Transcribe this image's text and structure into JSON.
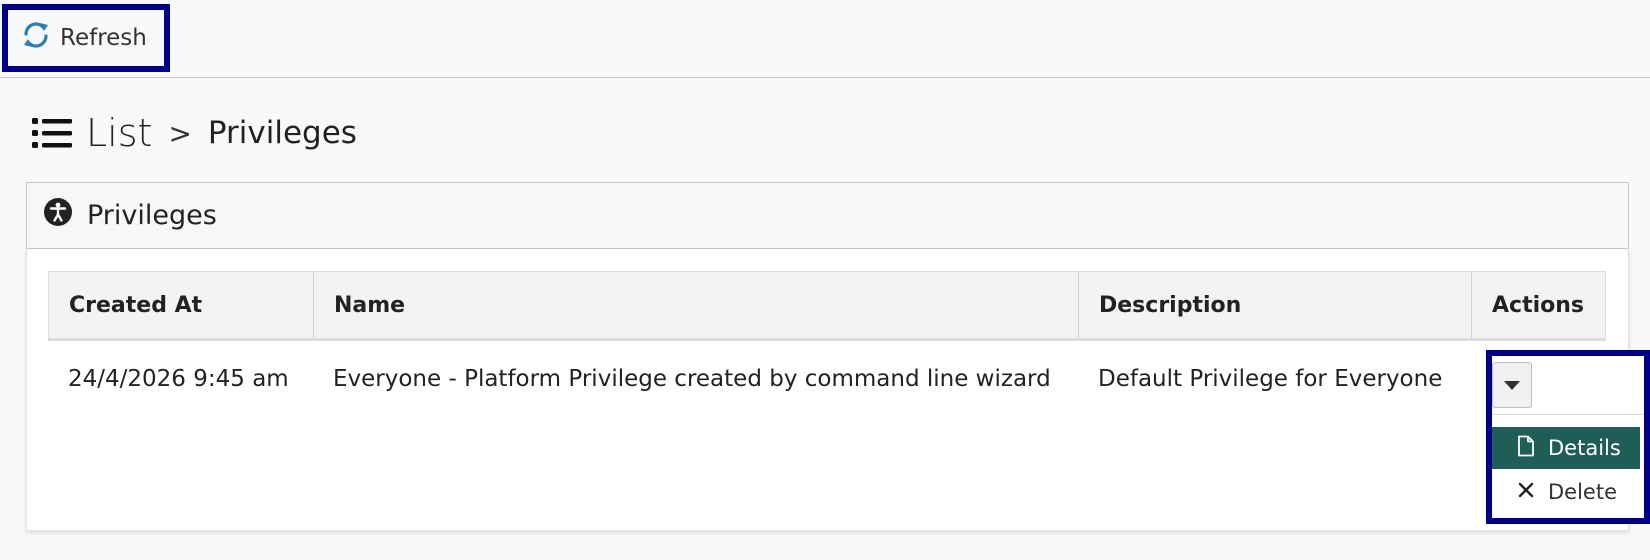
{
  "toolbar": {
    "refresh_label": "Refresh",
    "refresh_icon": "refresh-icon"
  },
  "heading": {
    "list_label": "List",
    "separator": ">",
    "page_label": "Privileges",
    "list_icon": "list-icon"
  },
  "panel": {
    "title": "Privileges",
    "icon": "accessibility-icon"
  },
  "table": {
    "columns": [
      "Created At",
      "Name",
      "Description",
      "Actions"
    ],
    "rows": [
      {
        "created_at": "24/4/2026 9:45 am",
        "name": "Everyone - Platform Privilege created by command line wizard",
        "description": "Default Privilege for Everyone"
      }
    ]
  },
  "actions_menu": {
    "items": [
      {
        "label": "Details",
        "icon": "file-icon"
      },
      {
        "label": "Delete",
        "icon": "close-icon"
      }
    ]
  },
  "colors": {
    "highlight_border": "#00008b",
    "details_bg": "#1f5e57",
    "refresh_icon": "#2a7fb8"
  }
}
